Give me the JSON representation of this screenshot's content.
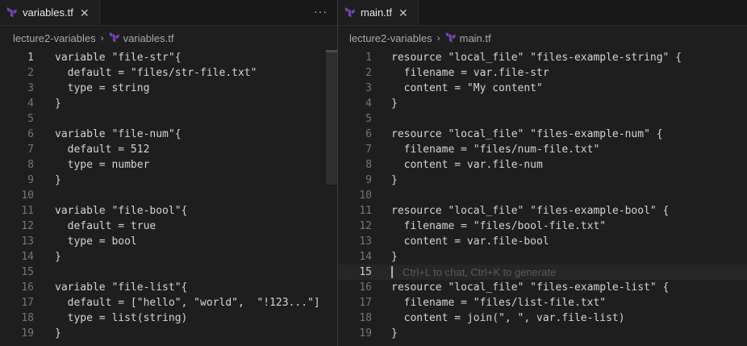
{
  "left": {
    "tab_label": "variables.tf",
    "tab_close": "✕",
    "more": "···",
    "breadcrumb": {
      "folder": "lecture2-variables",
      "separator": "›",
      "file": "variables.tf"
    },
    "lines": [
      {
        "n": "1",
        "text": "variable \"file-str\"{"
      },
      {
        "n": "2",
        "text": "  default = \"files/str-file.txt\""
      },
      {
        "n": "3",
        "text": "  type = string"
      },
      {
        "n": "4",
        "text": "}"
      },
      {
        "n": "5",
        "text": ""
      },
      {
        "n": "6",
        "text": "variable \"file-num\"{"
      },
      {
        "n": "7",
        "text": "  default = 512"
      },
      {
        "n": "8",
        "text": "  type = number"
      },
      {
        "n": "9",
        "text": "}"
      },
      {
        "n": "10",
        "text": ""
      },
      {
        "n": "11",
        "text": "variable \"file-bool\"{"
      },
      {
        "n": "12",
        "text": "  default = true"
      },
      {
        "n": "13",
        "text": "  type = bool"
      },
      {
        "n": "14",
        "text": "}"
      },
      {
        "n": "15",
        "text": ""
      },
      {
        "n": "16",
        "text": "variable \"file-list\"{"
      },
      {
        "n": "17",
        "text": "  default = [\"hello\", \"world\",  \"!123...\"]"
      },
      {
        "n": "18",
        "text": "  type = list(string)"
      },
      {
        "n": "19",
        "text": "}"
      }
    ]
  },
  "right": {
    "tab_label": "main.tf",
    "tab_close": "✕",
    "breadcrumb": {
      "folder": "lecture2-variables",
      "separator": "›",
      "file": "main.tf"
    },
    "ghost_hint": "Ctrl+L to chat, Ctrl+K to generate",
    "lines": [
      {
        "n": "1",
        "text": "resource \"local_file\" \"files-example-string\" {"
      },
      {
        "n": "2",
        "text": "  filename = var.file-str"
      },
      {
        "n": "3",
        "text": "  content = \"My content\""
      },
      {
        "n": "4",
        "text": "}"
      },
      {
        "n": "5",
        "text": ""
      },
      {
        "n": "6",
        "text": "resource \"local_file\" \"files-example-num\" {"
      },
      {
        "n": "7",
        "text": "  filename = \"files/num-file.txt\""
      },
      {
        "n": "8",
        "text": "  content = var.file-num"
      },
      {
        "n": "9",
        "text": "}"
      },
      {
        "n": "10",
        "text": ""
      },
      {
        "n": "11",
        "text": "resource \"local_file\" \"files-example-bool\" {"
      },
      {
        "n": "12",
        "text": "  filename = \"files/bool-file.txt\""
      },
      {
        "n": "13",
        "text": "  content = var.file-bool"
      },
      {
        "n": "14",
        "text": "}"
      },
      {
        "n": "15",
        "text": ""
      },
      {
        "n": "16",
        "text": "resource \"local_file\" \"files-example-list\" {"
      },
      {
        "n": "17",
        "text": "  filename = \"files/list-file.txt\""
      },
      {
        "n": "18",
        "text": "  content = join(\", \", var.file-list)"
      },
      {
        "n": "19",
        "text": "}"
      }
    ]
  },
  "colors": {
    "terraform_icon": "#7b42bc",
    "editor_bg": "#1e1e1e"
  }
}
